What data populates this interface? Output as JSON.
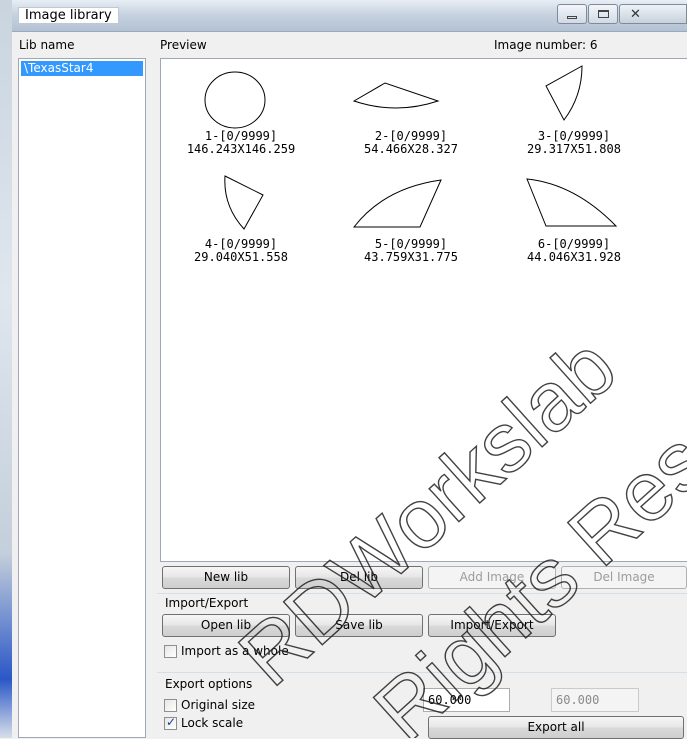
{
  "window": {
    "title": "Image library"
  },
  "lib_panel": {
    "header": "Lib name",
    "items": [
      "\\TexasStar4"
    ]
  },
  "preview": {
    "header": "Preview",
    "count_label": "Image number:",
    "count_value": "6",
    "images": [
      {
        "name": "1-[0/9999]",
        "size": "146.243X146.259",
        "shape": "circle-icon"
      },
      {
        "name": "2-[0/9999]",
        "size": "54.466X28.327",
        "shape": "fan-segment-icon"
      },
      {
        "name": "3-[0/9999]",
        "size": "29.317X51.808",
        "shape": "fan-segment-icon"
      },
      {
        "name": "4-[0/9999]",
        "size": "29.040X51.558",
        "shape": "fan-segment-icon"
      },
      {
        "name": "5-[0/9999]",
        "size": "43.759X31.775",
        "shape": "fan-segment-icon"
      },
      {
        "name": "6-[0/9999]",
        "size": "44.046X31.928",
        "shape": "fan-segment-icon"
      }
    ]
  },
  "lib_buttons": {
    "new": "New lib",
    "del": "Del lib",
    "add_image": "Add Image",
    "del_image": "Del Image"
  },
  "import_export": {
    "group_label": "Import/Export",
    "open": "Open lib",
    "save": "Save lib",
    "import_export": "Import/Export",
    "import_whole_label": "Import as a whole",
    "import_whole_checked": false
  },
  "export_options": {
    "group_label": "Export options",
    "original_size_label": "Original size",
    "original_size_checked": false,
    "lock_scale_label": "Lock scale",
    "lock_scale_checked": true,
    "width_value": "60.000",
    "height_value": "60.000",
    "export_all": "Export all"
  },
  "watermark": {
    "line1": "RDWorkslab",
    "line2": "Rights Reserved"
  },
  "colors": {
    "selection": "#3399ff",
    "window_bg": "#f0f0f0"
  }
}
